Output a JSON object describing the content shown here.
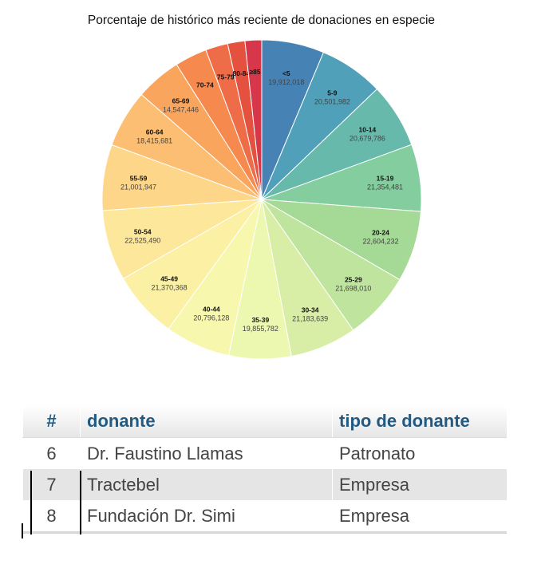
{
  "chart_data": {
    "type": "pie",
    "title": "Porcentaje de histórico más reciente de donaciones en especie",
    "slices": [
      {
        "label": "<5",
        "value": 19912018,
        "display": "19,912,018",
        "color": "#4682b4"
      },
      {
        "label": "5-9",
        "value": 20501982,
        "display": "20,501,982",
        "color": "#4fa0b8"
      },
      {
        "label": "10-14",
        "value": 20679786,
        "display": "20,679,786",
        "color": "#67b9ac"
      },
      {
        "label": "15-19",
        "value": 21354481,
        "display": "21,354,481",
        "color": "#84cd9e"
      },
      {
        "label": "20-24",
        "value": 22604232,
        "display": "22,604,232",
        "color": "#a4d996"
      },
      {
        "label": "25-29",
        "value": 21698010,
        "display": "21,698,010",
        "color": "#bfe49d"
      },
      {
        "label": "30-34",
        "value": 21183639,
        "display": "21,183,639",
        "color": "#d8eea7"
      },
      {
        "label": "35-39",
        "value": 19855782,
        "display": "19,855,782",
        "color": "#ecf7b0"
      },
      {
        "label": "40-44",
        "value": 20796128,
        "display": "20,796,128",
        "color": "#f7f7ad"
      },
      {
        "label": "45-49",
        "value": 21370368,
        "display": "21,370,368",
        "color": "#fbf0a3"
      },
      {
        "label": "50-54",
        "value": 22525490,
        "display": "22,525,490",
        "color": "#fde79b"
      },
      {
        "label": "55-59",
        "value": 21001947,
        "display": "21,001,947",
        "color": "#fdd68a"
      },
      {
        "label": "60-64",
        "value": 18415681,
        "display": "18,415,681",
        "color": "#fcbe72"
      },
      {
        "label": "65-69",
        "value": 14547446,
        "display": "14,547,446",
        "color": "#f9a55d"
      },
      {
        "label": "70-74",
        "value": 10300000,
        "display": "",
        "color": "#f5894e"
      },
      {
        "label": "75-79",
        "value": 7100000,
        "display": "",
        "color": "#ee6c47"
      },
      {
        "label": "80-84",
        "value": 5500000,
        "display": "",
        "color": "#e4523f"
      },
      {
        "label": "≥85",
        "value": 5300000,
        "display": "",
        "color": "#d6374a"
      }
    ]
  },
  "table": {
    "headers": [
      "#",
      "donante",
      "tipo de donante"
    ],
    "rows": [
      [
        "6",
        "Dr. Faustino Llamas",
        "Patronato"
      ],
      [
        "7",
        "Tractebel",
        "Empresa"
      ],
      [
        "8",
        "Fundación Dr. Simi",
        "Empresa"
      ]
    ]
  }
}
